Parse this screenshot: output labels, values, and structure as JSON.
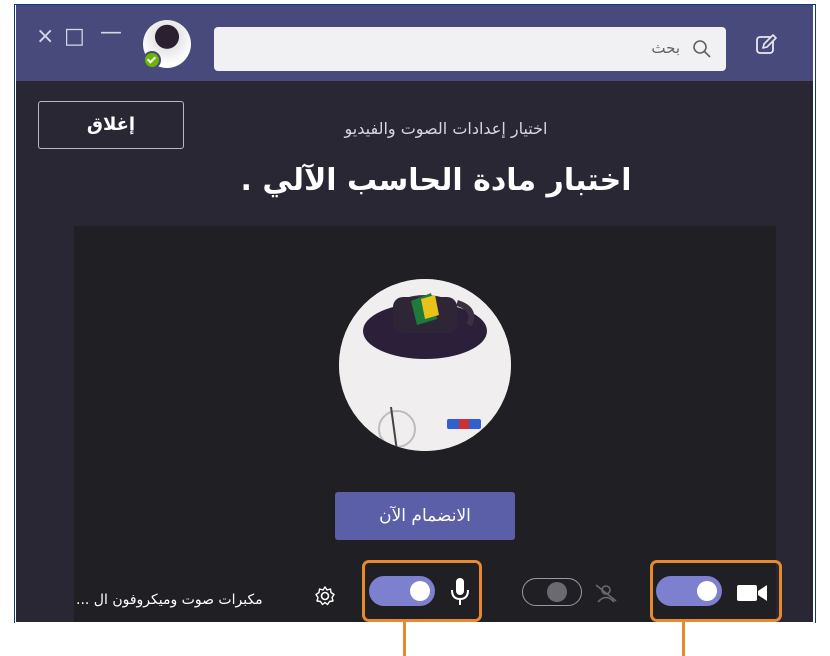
{
  "window": {
    "controls": {
      "close": "×",
      "maximize": "□",
      "minimize": "—"
    }
  },
  "header": {
    "search_placeholder": "بحث",
    "icons": [
      "search-icon",
      "compose-icon"
    ]
  },
  "dialog": {
    "subtitle": "اختيار إعدادات الصوت والفيديو",
    "title": "اختبار مادة الحاسب الآلي .",
    "close_label": "إغلاق",
    "join_label": "الانضمام الآن"
  },
  "controls": {
    "camera_on": true,
    "blur_on": false,
    "mic_on": true,
    "device_label": "مكبرات صوت وميكروفون ال ..."
  },
  "colors": {
    "titlebar": "#494a7c",
    "background": "#292733",
    "accent": "#5b5fa8",
    "highlight": "#e9892f"
  }
}
